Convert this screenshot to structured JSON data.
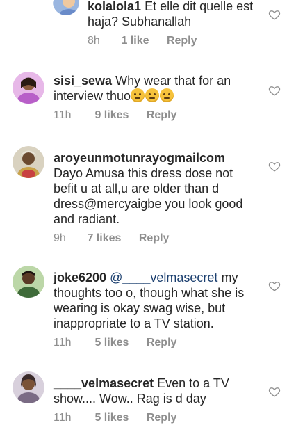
{
  "comments": [
    {
      "username": "kolalola1",
      "text": "Et elle dit quelle est haja? Subhanallah",
      "time": "8h",
      "likes": "1 like",
      "reply": "Reply",
      "avatar_color": "#6a8bc9"
    },
    {
      "username": "sisi_sewa",
      "text": "Why wear that for an interview thuo",
      "emoji_count": 3,
      "time": "11h",
      "likes": "9 likes",
      "reply": "Reply",
      "avatar_color": "#b85fc8"
    },
    {
      "username": "aroyeunmotunrayogmailcom",
      "text": "Dayo Amusa this dress dose not befit u at all,u are older than d dress@mercyaigbe you look good and radiant.",
      "time": "9h",
      "likes": "7 likes",
      "reply": "Reply",
      "avatar_color": "#c9a24a"
    },
    {
      "username": "joke6200",
      "mention": "@____velmasecret",
      "text": "my thoughts too o, though what she is wearing is okay swag wise, but inappropriate to a TV station.",
      "time": "11h",
      "likes": "5 likes",
      "reply": "Reply",
      "avatar_color": "#3f6b3a"
    },
    {
      "username": "____velmasecret",
      "text": "Even to a TV show.... Wow.. Rag is d day",
      "time": "11h",
      "likes": "5 likes",
      "reply": "Reply",
      "avatar_color": "#7a6b84"
    }
  ]
}
